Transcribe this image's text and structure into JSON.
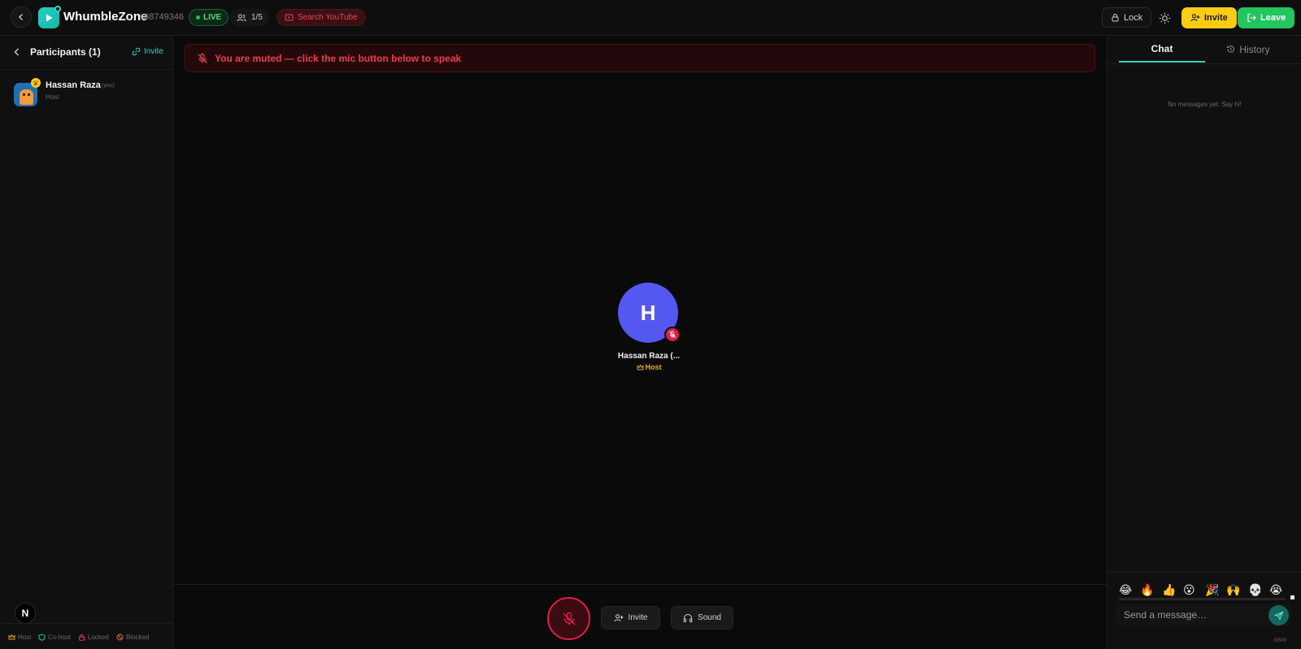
{
  "header": {
    "app_title": "WhumbleZone",
    "room_id": "#88749346",
    "live_label": "LIVE",
    "participant_count": "1/5",
    "youtube_label": "Search YouTube",
    "lock_label": "Lock",
    "invite_label": "Invite",
    "leave_label": "Leave"
  },
  "participants_panel": {
    "title": "Participants (1)",
    "invite_label": "Invite",
    "items": [
      {
        "name": "Hassan Raza",
        "you_tag": "(you)",
        "role": "Host"
      }
    ],
    "legend": [
      {
        "label": "Host",
        "icon": "crown-icon",
        "color": "#eab308"
      },
      {
        "label": "Co-host",
        "icon": "shield-icon",
        "color": "#2dd4bf"
      },
      {
        "label": "Locked",
        "icon": "lock-icon",
        "color": "#f43f5e"
      },
      {
        "label": "Blocked",
        "icon": "blocked-icon",
        "color": "#f97316"
      }
    ],
    "n_badge": "N"
  },
  "stage": {
    "muted_banner": "You are muted — click the mic button below to speak",
    "tile": {
      "initial": "H",
      "name": "Hassan Raza (...",
      "role": "Host"
    }
  },
  "controls": {
    "invite_label": "Invite",
    "sound_label": "Sound"
  },
  "chat_panel": {
    "tab_chat": "Chat",
    "tab_history": "History",
    "empty_message": "No messages yet. Say hi!",
    "emojis": [
      "😂",
      "🔥",
      "👍",
      "😮",
      "🎉",
      "🙌",
      "💀",
      "😭"
    ],
    "input_placeholder": "Send a message…",
    "char_count": "0/500"
  },
  "colors": {
    "accent": "#2dd4bf",
    "live_green": "#22c55e",
    "danger": "#e11d48",
    "invite_yellow": "#facc15",
    "avatar_purple": "#5458f1"
  }
}
